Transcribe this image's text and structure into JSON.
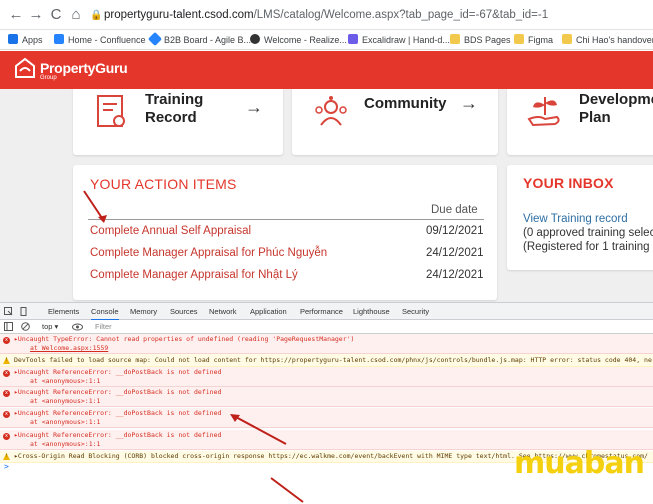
{
  "browser": {
    "url_host": "propertyguru-talent.csod.com",
    "url_path": "/LMS/catalog/Welcome.aspx?tab_page_id=-67&tab_id=-1",
    "nav_back": "←",
    "nav_forward": "→",
    "nav_reload": "C",
    "nav_home": "⌂",
    "bookmarks": [
      {
        "label": "Apps",
        "color": "#1a73e8"
      },
      {
        "label": "Home - Confluence",
        "color": "#2684ff"
      },
      {
        "label": "B2B Board - Agile B...",
        "color": "#2684ff"
      },
      {
        "label": "Welcome - Realize...",
        "color": "#333333"
      },
      {
        "label": "Excalidraw | Hand-d...",
        "color": "#6c5ce7"
      },
      {
        "label": "BDS Pages",
        "color": "#f2c94c"
      },
      {
        "label": "Figma",
        "color": "#f2c94c"
      },
      {
        "label": "Chi Hao's handover",
        "color": "#f2c94c"
      }
    ]
  },
  "header": {
    "brand": "PropertyGuru",
    "brand_sub": "Group",
    "brand_color": "#e4362b"
  },
  "cards": [
    {
      "title_line1": "Training",
      "title_line2": "Record",
      "arrow": "→"
    },
    {
      "title_line1": "Community",
      "arrow": "→"
    },
    {
      "title_line1": "Developme",
      "title_line2": "Plan"
    }
  ],
  "action_items": {
    "title": "YOUR ACTION ITEMS",
    "due_header": "Due date",
    "items": [
      {
        "label": "Complete Annual Self Appraisal",
        "date": "09/12/2021"
      },
      {
        "label": "Complete Manager Appraisal for Phúc Nguyễn",
        "date": "24/12/2021"
      },
      {
        "label": "Complete Manager Appraisal for Nhật Lý",
        "date": "24/12/2021"
      }
    ]
  },
  "inbox": {
    "title": "YOUR INBOX",
    "link": "View Training record",
    "line1": "(0 approved training select",
    "line2": "(Registered for 1 training s"
  },
  "devtools": {
    "tabs": [
      "Elements",
      "Console",
      "Memory",
      "Sources",
      "Network",
      "Application",
      "Performance",
      "Lighthouse",
      "Security"
    ],
    "active_tab": "Console",
    "context": "top ▾",
    "filter_placeholder": "Filter",
    "messages": [
      {
        "type": "err",
        "text": "▸Uncaught TypeError: Cannot read properties of undefined (reading 'PageRequestManager')",
        "sub": "at Welcome.aspx:1559"
      },
      {
        "type": "warn",
        "text": "DevTools failed to load source map: Could not load content for https://propertyguru-talent.csod.com/phnx/js/controls/bundle.js.map: HTTP error: status code 404, ne"
      },
      {
        "type": "err",
        "text": "▸Uncaught ReferenceError: __doPostBack is not defined",
        "sub": "at <anonymous>:1:1"
      },
      {
        "type": "err",
        "text": "▸Uncaught ReferenceError: __doPostBack is not defined",
        "sub": "at <anonymous>:1:1"
      },
      {
        "type": "err",
        "text": "▸Uncaught ReferenceError: __doPostBack is not defined",
        "sub": "at <anonymous>:1:1"
      },
      {
        "type": "err",
        "text": "▸Uncaught ReferenceError: __doPostBack is not defined",
        "sub": "at <anonymous>:1:1"
      },
      {
        "type": "warn",
        "text": "▸Cross-Origin Read Blocking (CORB) blocked cross-origin response https://ec.walkme.com/event/backEvent with MIME type text/html. See https://www.chromestatus.com/"
      }
    ],
    "prompt": ">"
  },
  "watermark": "muaban"
}
